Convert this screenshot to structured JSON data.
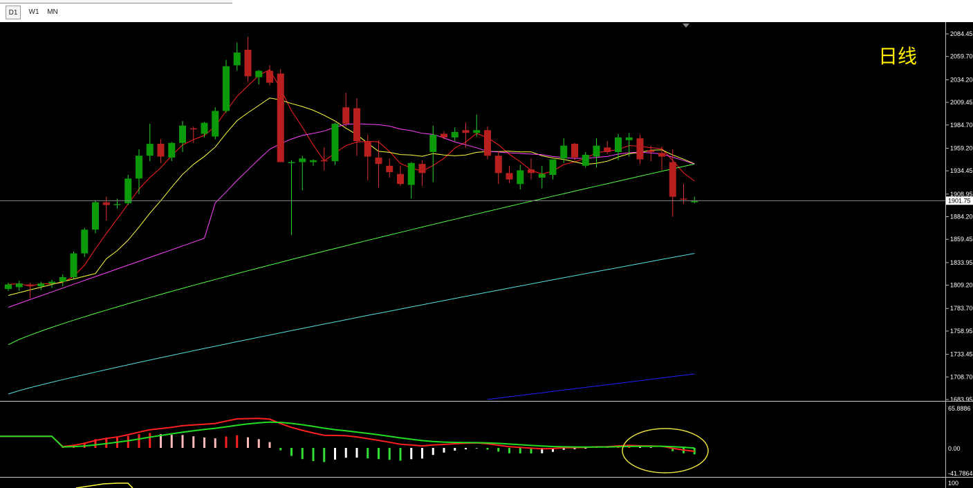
{
  "toolbar": {
    "timeframes": [
      "D1",
      "W1",
      "MN"
    ],
    "active": "D1"
  },
  "main_panel": {
    "title": "日线",
    "title_color": "#ffee00",
    "current_price": "1901.75",
    "y_ticks": [
      "2084.45",
      "2059.70",
      "2034.20",
      "2009.45",
      "1984.70",
      "1959.20",
      "1934.45",
      "1908.95",
      "1884.20",
      "1859.45",
      "1833.95",
      "1809.20",
      "1783.70",
      "1758.95",
      "1733.45",
      "1708.70",
      "1683.95"
    ]
  },
  "macd_panel": {
    "y_ticks": [
      "65.8886",
      "0.00",
      "-41.7864"
    ]
  },
  "bottom_panel": {
    "y_ticks": [
      "100"
    ]
  },
  "colors": {
    "background": "#000000",
    "bull": "#0a9a0a",
    "bear": "#b82020",
    "ma5": "#ff2020",
    "ma10": "#ffff40",
    "ma20": "#ff44ff",
    "ma60": "#55ff44",
    "ma120": "#55e0e0",
    "ma250": "#2222ff",
    "dif": "#ff2020",
    "dea": "#22dd22",
    "ellipse": "#e8e040"
  },
  "chart_data": {
    "type": "candlestick",
    "ylim": [
      1683.95,
      2090
    ],
    "ohlc": [
      [
        1805,
        1812,
        1803,
        1810
      ],
      [
        1807,
        1814,
        1803,
        1811
      ],
      [
        1810,
        1812,
        1795,
        1808
      ],
      [
        1808,
        1813,
        1804,
        1811
      ],
      [
        1811,
        1815,
        1806,
        1813
      ],
      [
        1813,
        1821,
        1808,
        1818
      ],
      [
        1818,
        1846,
        1816,
        1844
      ],
      [
        1844,
        1872,
        1840,
        1870
      ],
      [
        1870,
        1902,
        1866,
        1900
      ],
      [
        1900,
        1906,
        1880,
        1897
      ],
      [
        1897,
        1904,
        1893,
        1898
      ],
      [
        1899,
        1930,
        1897,
        1926
      ],
      [
        1926,
        1958,
        1909,
        1951
      ],
      [
        1951,
        1986,
        1945,
        1964
      ],
      [
        1964,
        1969,
        1943,
        1950
      ],
      [
        1949,
        1966,
        1945,
        1965
      ],
      [
        1965,
        1989,
        1955,
        1984
      ],
      [
        1981,
        1983,
        1965,
        1980
      ],
      [
        1975,
        1988,
        1971,
        1987
      ],
      [
        1972,
        2004,
        1969,
        2000
      ],
      [
        2000,
        2056,
        1998,
        2049
      ],
      [
        2050,
        2075,
        2044,
        2064
      ],
      [
        2067,
        2081,
        2032,
        2038
      ],
      [
        2037,
        2045,
        2029,
        2044
      ],
      [
        2044,
        2050,
        2028,
        2031
      ],
      [
        2041,
        2046,
        1945,
        1944
      ],
      [
        1943,
        1946,
        1864,
        1944
      ],
      [
        1944,
        1951,
        1913,
        1948
      ],
      [
        1944,
        1947,
        1940,
        1946
      ],
      [
        1946,
        1960,
        1935,
        1945
      ],
      [
        1945,
        1987,
        1941,
        1986
      ],
      [
        2004,
        2020,
        1983,
        1986
      ],
      [
        2003,
        2014,
        1951,
        1967
      ],
      [
        1967,
        1974,
        1924,
        1950
      ],
      [
        1949,
        1968,
        1916,
        1942
      ],
      [
        1940,
        1948,
        1927,
        1933
      ],
      [
        1931,
        1940,
        1918,
        1920
      ],
      [
        1919,
        1944,
        1904,
        1943
      ],
      [
        1942,
        1946,
        1918,
        1932
      ],
      [
        1955,
        1984,
        1922,
        1974
      ],
      [
        1975,
        1978,
        1969,
        1971
      ],
      [
        1971,
        1982,
        1967,
        1977
      ],
      [
        1979,
        1987,
        1960,
        1976
      ],
      [
        1976,
        1996,
        1972,
        1979
      ],
      [
        1979,
        1983,
        1947,
        1951
      ],
      [
        1951,
        1956,
        1920,
        1932
      ],
      [
        1932,
        1940,
        1921,
        1925
      ],
      [
        1920,
        1941,
        1914,
        1935
      ],
      [
        1936,
        1948,
        1925,
        1932
      ],
      [
        1927,
        1940,
        1915,
        1931
      ],
      [
        1930,
        1946,
        1925,
        1947
      ],
      [
        1948,
        1970,
        1943,
        1962
      ],
      [
        1964,
        1965,
        1946,
        1949
      ],
      [
        1940,
        1955,
        1938,
        1952
      ],
      [
        1950,
        1970,
        1938,
        1962
      ],
      [
        1960,
        1967,
        1953,
        1955
      ],
      [
        1955,
        1975,
        1946,
        1971
      ],
      [
        1968,
        1976,
        1950,
        1971
      ],
      [
        1970,
        1974,
        1942,
        1947
      ],
      [
        1957,
        1962,
        1945,
        1955
      ],
      [
        1954,
        1961,
        1935,
        1950
      ],
      [
        1944,
        1958,
        1884,
        1906
      ],
      [
        1904,
        1920,
        1898,
        1903
      ],
      [
        1900,
        1906,
        1899,
        1902
      ]
    ]
  }
}
